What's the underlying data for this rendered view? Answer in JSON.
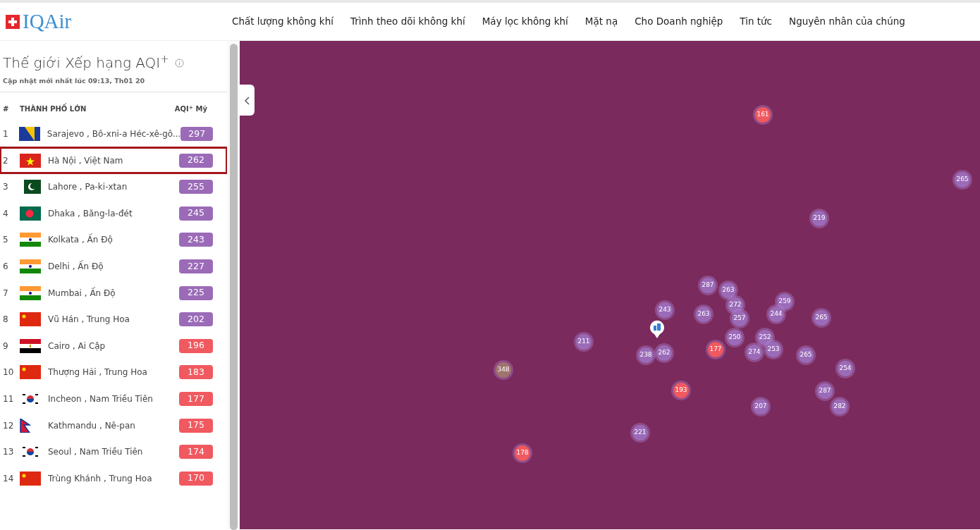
{
  "header": {
    "logo": "IQAir",
    "nav": [
      "Chất lượng không khí",
      "Trình theo dõi không khí",
      "Máy lọc không khí",
      "Mặt nạ",
      "Cho Doanh nghiệp",
      "Tin tức",
      "Nguyên nhân của chúng"
    ]
  },
  "ranking": {
    "title": "Thế giới Xếp hạng AQI$^{+}$",
    "updated": "Cập nhật mới nhất lúc 09:13, Th01 20",
    "columns": [
      "#",
      "THÀNH PHỐ LỚN",
      "AQI$^{+}$ Mỹ"
    ],
    "rows": [
      {
        "rank": "1",
        "kind": "ba",
        "city": "Sarajevo , Bô-xni-a Héc-xê-gô...",
        "aqi": "297",
        "color": "#9b6bb8",
        "selected": false
      },
      {
        "rank": "2",
        "kind": "vn",
        "city": "Hà Nội , Việt Nam",
        "aqi": "262",
        "color": "#9b6bb8",
        "selected": true
      },
      {
        "rank": "3",
        "kind": "pk",
        "city": "Lahore , Pa-ki-xtan",
        "aqi": "255",
        "color": "#9b6bb8",
        "selected": false
      },
      {
        "rank": "4",
        "kind": "bd",
        "city": "Dhaka , Băng-la-đét",
        "aqi": "245",
        "color": "#9b6bb8",
        "selected": false
      },
      {
        "rank": "5",
        "kind": "in",
        "city": "Kolkata , Ấn Độ",
        "aqi": "243",
        "color": "#9b6bb8",
        "selected": false
      },
      {
        "rank": "6",
        "kind": "in",
        "city": "Delhi , Ấn Độ",
        "aqi": "227",
        "color": "#9b6bb8",
        "selected": false
      },
      {
        "rank": "7",
        "kind": "in",
        "city": "Mumbai , Ấn Độ",
        "aqi": "225",
        "color": "#9b6bb8",
        "selected": false
      },
      {
        "rank": "8",
        "kind": "cn",
        "city": "Vũ Hán , Trung Hoa",
        "aqi": "202",
        "color": "#9b6bb8",
        "selected": false
      },
      {
        "rank": "9",
        "kind": "eg",
        "city": "Cairo , Ai Cập",
        "aqi": "196",
        "color": "#f0595f",
        "selected": false
      },
      {
        "rank": "10",
        "kind": "cn",
        "city": "Thượng Hải , Trung Hoa",
        "aqi": "183",
        "color": "#f0595f",
        "selected": false
      },
      {
        "rank": "11",
        "kind": "kr",
        "city": "Incheon , Nam Triều Tiên",
        "aqi": "177",
        "color": "#f0595f",
        "selected": false
      },
      {
        "rank": "12",
        "kind": "np",
        "city": "Kathmandu , Nê-pan",
        "aqi": "175",
        "color": "#f0595f",
        "selected": false
      },
      {
        "rank": "13",
        "kind": "kr",
        "city": "Seoul , Nam Triều Tiên",
        "aqi": "174",
        "color": "#f0595f",
        "selected": false
      },
      {
        "rank": "14",
        "kind": "cn",
        "city": "Trùng Khánh , Trung Hoa",
        "aqi": "170",
        "color": "#f0595f",
        "selected": false
      }
    ]
  },
  "map": {
    "markers": [
      {
        "aqi": "161",
        "color": "#f0595f"
      },
      {
        "aqi": "265",
        "color": "#9b6bb8"
      },
      {
        "aqi": "219",
        "color": "#9b6bb8"
      },
      {
        "aqi": "287",
        "color": "#9b6bb8"
      },
      {
        "aqi": "263",
        "color": "#9b6bb8"
      },
      {
        "aqi": "243",
        "color": "#9b6bb8"
      },
      {
        "aqi": "263",
        "color": "#9b6bb8"
      },
      {
        "aqi": "272",
        "color": "#9b6bb8"
      },
      {
        "aqi": "259",
        "color": "#9b6bb8"
      },
      {
        "aqi": "244",
        "color": "#9b6bb8"
      },
      {
        "aqi": "257",
        "color": "#9b6bb8"
      },
      {
        "aqi": "265",
        "color": "#9b6bb8"
      },
      {
        "aqi": "211",
        "color": "#9b6bb8"
      },
      {
        "aqi": "238",
        "color": "#9b6bb8"
      },
      {
        "aqi": "262",
        "color": "#9b6bb8"
      },
      {
        "aqi": "177",
        "color": "#f0595f"
      },
      {
        "aqi": "250",
        "color": "#9b6bb8"
      },
      {
        "aqi": "252",
        "color": "#9b6bb8"
      },
      {
        "aqi": "274",
        "color": "#9b6bb8"
      },
      {
        "aqi": "253",
        "color": "#9b6bb8"
      },
      {
        "aqi": "265",
        "color": "#9b6bb8"
      },
      {
        "aqi": "254",
        "color": "#9b6bb8"
      },
      {
        "aqi": "348",
        "color": "#a0736d"
      },
      {
        "aqi": "193",
        "color": "#f0595f"
      },
      {
        "aqi": "287",
        "color": "#9b6bb8"
      },
      {
        "aqi": "207",
        "color": "#9b6bb8"
      },
      {
        "aqi": "282",
        "color": "#9b6bb8"
      },
      {
        "aqi": "221",
        "color": "#9b6bb8"
      },
      {
        "aqi": "178",
        "color": "#f0595f"
      }
    ]
  }
}
